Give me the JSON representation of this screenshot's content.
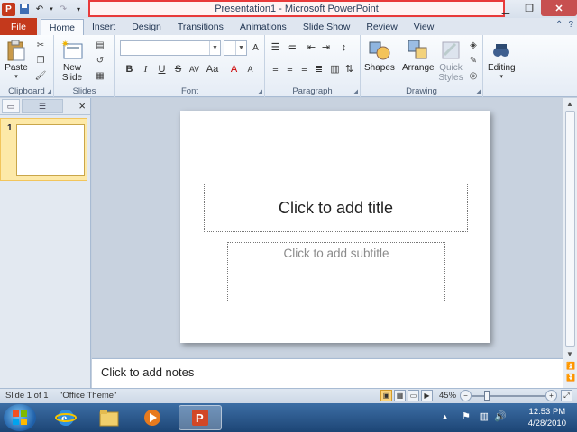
{
  "window": {
    "title": "Presentation1 - Microsoft PowerPoint",
    "app_icon_letter": "P",
    "controls": [
      "minimize",
      "restore",
      "close"
    ]
  },
  "tabs": [
    {
      "label": "File"
    },
    {
      "label": "Home"
    },
    {
      "label": "Insert"
    },
    {
      "label": "Design"
    },
    {
      "label": "Transitions"
    },
    {
      "label": "Animations"
    },
    {
      "label": "Slide Show"
    },
    {
      "label": "Review"
    },
    {
      "label": "View"
    }
  ],
  "ribbon": {
    "clipboard": {
      "label": "Clipboard",
      "paste": "Paste"
    },
    "slides": {
      "label": "Slides",
      "new_slide_line1": "New",
      "new_slide_line2": "Slide"
    },
    "font": {
      "label": "Font",
      "font_name": "",
      "font_size": ""
    },
    "paragraph": {
      "label": "Paragraph"
    },
    "drawing": {
      "label": "Drawing",
      "shapes": "Shapes",
      "arrange": "Arrange",
      "quick_styles_line1": "Quick",
      "quick_styles_line2": "Styles"
    },
    "editing": {
      "label": "Editing"
    }
  },
  "slide_pane": {
    "thumbnail_number": "1"
  },
  "slide": {
    "title_placeholder": "Click to add title",
    "subtitle_placeholder": "Click to add subtitle"
  },
  "notes": {
    "placeholder": "Click to add notes"
  },
  "status": {
    "slide_info": "Slide 1 of 1",
    "theme": "\"Office Theme\"",
    "zoom": "45%"
  },
  "taskbar": {
    "time": "12:53 PM",
    "date": "4/28/2010"
  }
}
